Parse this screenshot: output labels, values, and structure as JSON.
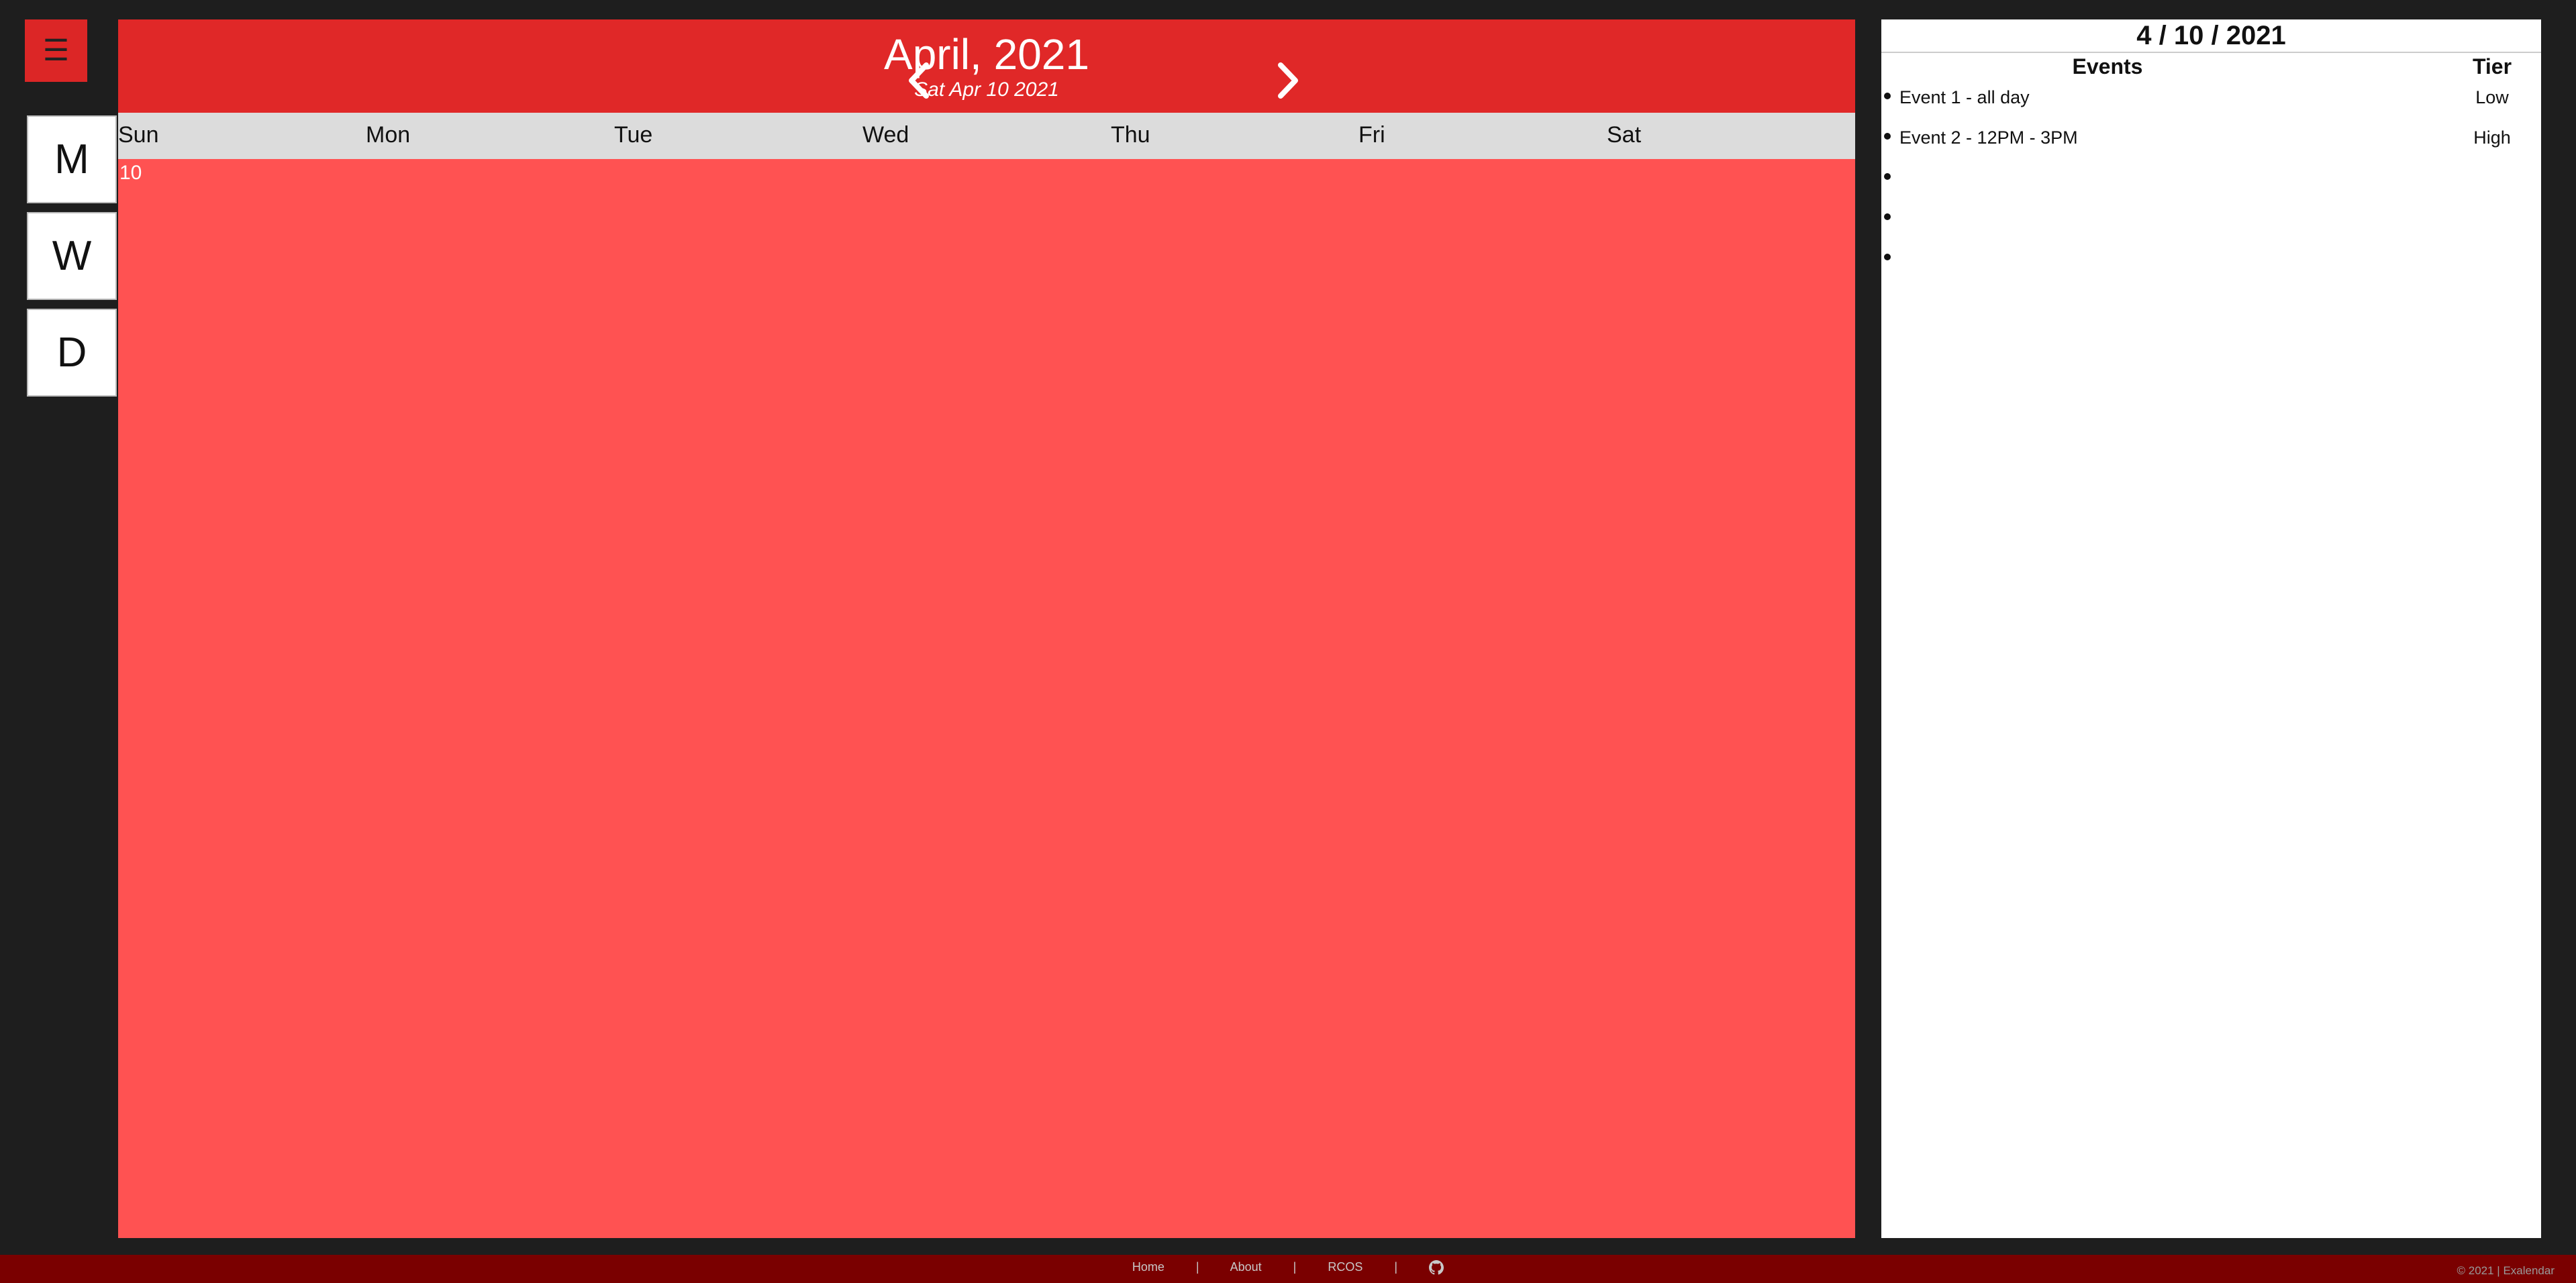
{
  "menu": {
    "icon": "hamburger-icon",
    "glyph": "☰"
  },
  "views": [
    {
      "label": "M"
    },
    {
      "label": "W"
    },
    {
      "label": "D"
    }
  ],
  "calendar": {
    "month_title": "April, 2021",
    "selected_date": "Sat Apr 10 2021",
    "prev_icon": "chevron-left-icon",
    "next_icon": "chevron-right-icon",
    "weekdays": [
      "Sun",
      "Mon",
      "Tue",
      "Wed",
      "Thu",
      "Fri",
      "Sat"
    ],
    "day_number": "10",
    "colors": {
      "header": "#e02828",
      "body": "#ff5252",
      "weekday_bar": "#dcdcdc"
    }
  },
  "events_panel": {
    "date": "4 / 10 / 2021",
    "events_header": "Events",
    "tier_header": "Tier",
    "events": [
      {
        "name": "Event 1 - all day",
        "tier": "Low"
      },
      {
        "name": "Event 2 - 12PM - 3PM",
        "tier": "High"
      },
      {
        "name": "",
        "tier": ""
      },
      {
        "name": "",
        "tier": ""
      },
      {
        "name": "",
        "tier": ""
      }
    ]
  },
  "footer": {
    "links": [
      "Home",
      "About",
      "RCOS"
    ],
    "separator": "|",
    "github_icon": "github-icon",
    "copyright": "© 2021 | Exalendar",
    "color": "#7a0000"
  }
}
